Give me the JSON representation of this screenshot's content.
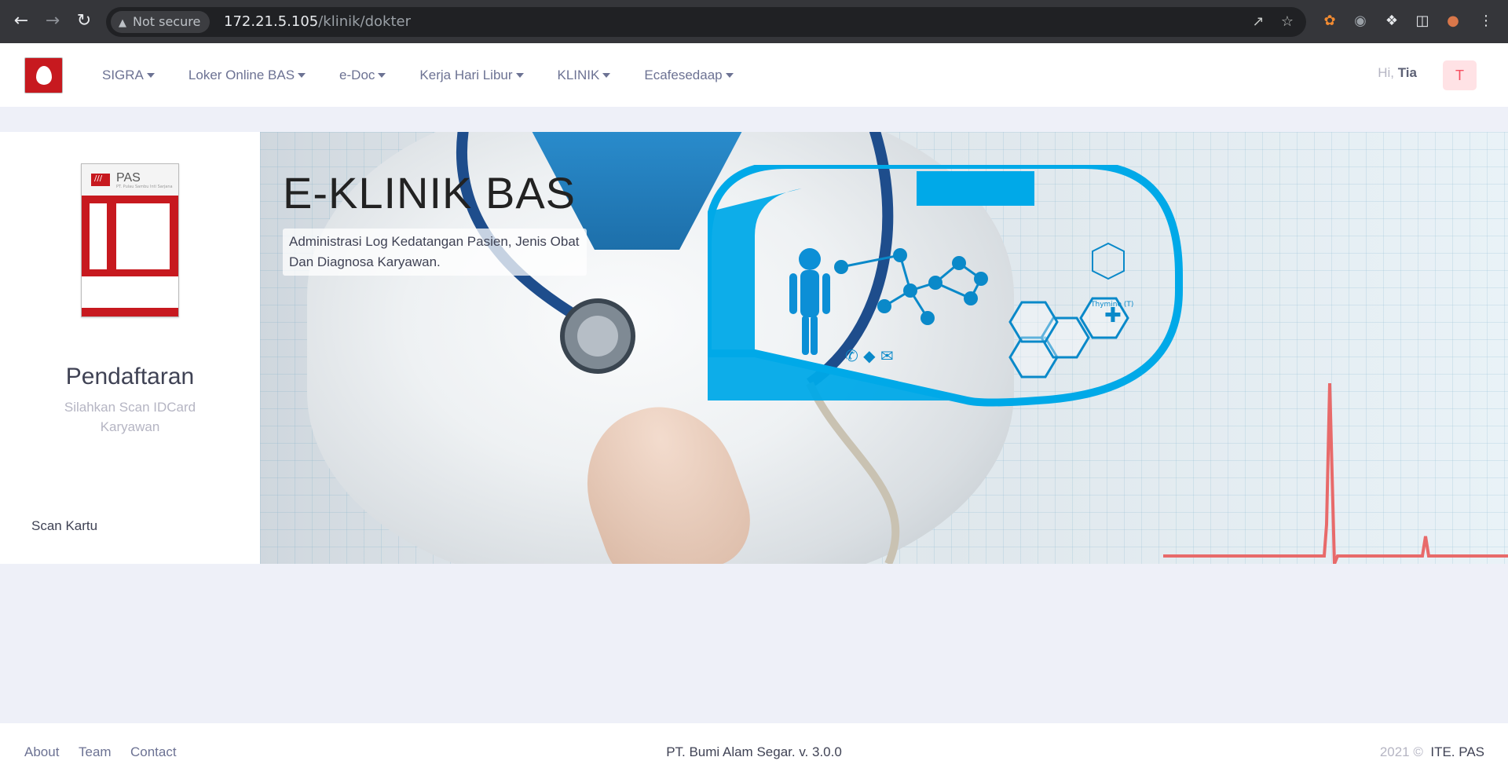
{
  "browser": {
    "security_label": "Not secure",
    "url_host": "172.21.5.105",
    "url_path": "/klinik/dokter"
  },
  "header": {
    "menu": [
      {
        "label": "SIGRA"
      },
      {
        "label": "Loker Online BAS"
      },
      {
        "label": "e-Doc"
      },
      {
        "label": "Kerja Hari Libur"
      },
      {
        "label": "KLINIK"
      },
      {
        "label": "Ecafesedaap"
      }
    ],
    "greeting_prefix": "Hi,",
    "user_name": "Tia",
    "avatar_initial": "T"
  },
  "left_panel": {
    "card_brand": "PAS",
    "card_brand_sub": "PT. Pulau Sambu Inti Sarjana",
    "title": "Pendaftaran",
    "subtitle": "Silahkan Scan IDCard Karyawan",
    "scan_button": "Scan Kartu"
  },
  "banner": {
    "title": "E-KLINIK BAS",
    "subtitle": "Administrasi Log Kedatangan Pasien, Jenis Obat Dan Diagnosa Karyawan.",
    "molecule_label": "Thymine (T)"
  },
  "footer": {
    "links": [
      "About",
      "Team",
      "Contact"
    ],
    "company": "PT. Bumi Alam Segar. v. 3.0.0",
    "year": "2021 ©",
    "org": "ITE. PAS"
  },
  "colors": {
    "brand_red": "#c7191f",
    "accent_blue": "#00a9e8",
    "avatar_bg": "#ffe2e5",
    "avatar_text": "#f64e60"
  }
}
